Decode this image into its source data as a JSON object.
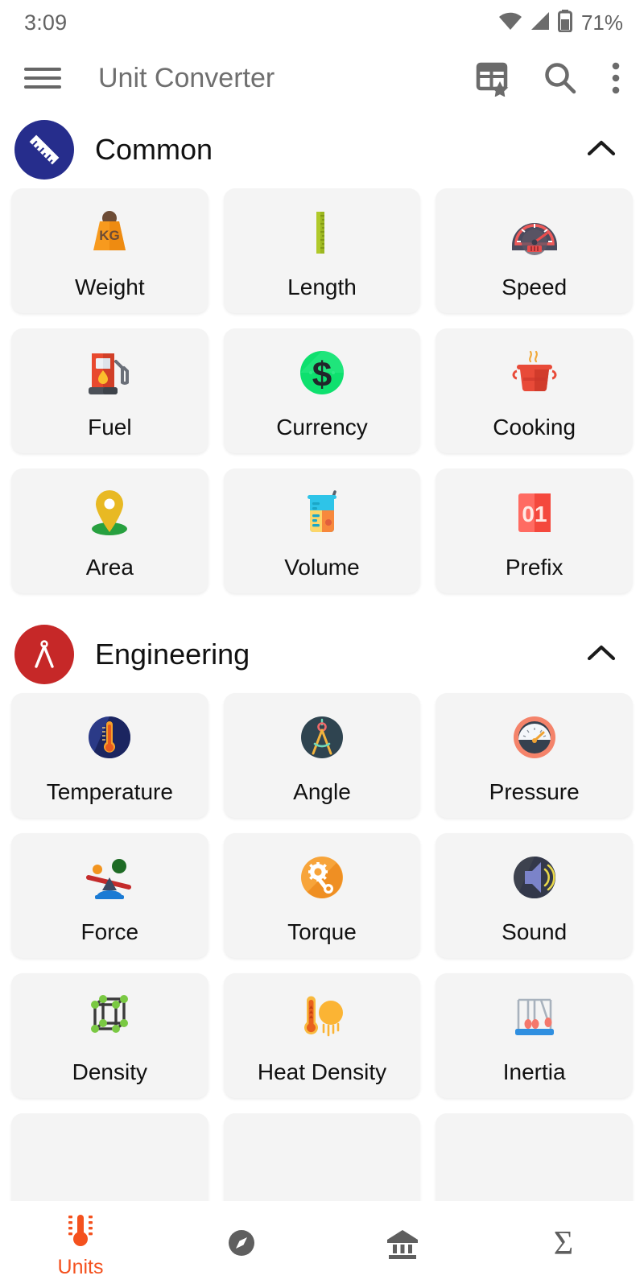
{
  "status_bar": {
    "time": "3:09",
    "battery_percent": "71%",
    "icons": [
      "wifi-icon",
      "cell-signal-icon",
      "battery-icon"
    ]
  },
  "toolbar": {
    "menu_icon": "hamburger-menu-icon",
    "title": "Unit Converter",
    "actions": [
      {
        "name": "favorites-grid-icon",
        "label": "Favorites grid"
      },
      {
        "name": "search-icon",
        "label": "Search"
      },
      {
        "name": "overflow-menu-icon",
        "label": "More options"
      }
    ]
  },
  "sections": [
    {
      "id": "common",
      "title": "Common",
      "badge_color": "#262d8c",
      "badge_icon": "ruler-icon",
      "expanded": true,
      "chevron": "chevron-up-icon",
      "items": [
        {
          "label": "Weight",
          "icon": "weight-kg-icon"
        },
        {
          "label": "Length",
          "icon": "ruler-vertical-icon"
        },
        {
          "label": "Speed",
          "icon": "speedometer-icon"
        },
        {
          "label": "Fuel",
          "icon": "fuel-pump-icon"
        },
        {
          "label": "Currency",
          "icon": "dollar-coin-icon"
        },
        {
          "label": "Cooking",
          "icon": "cooking-pot-icon"
        },
        {
          "label": "Area",
          "icon": "map-pin-icon"
        },
        {
          "label": "Volume",
          "icon": "beaker-icon"
        },
        {
          "label": "Prefix",
          "icon": "number-card-icon"
        }
      ]
    },
    {
      "id": "engineering",
      "title": "Engineering",
      "badge_color": "#c62828",
      "badge_icon": "compass-divider-icon",
      "expanded": true,
      "chevron": "chevron-up-icon",
      "items": [
        {
          "label": "Temperature",
          "icon": "thermometer-circle-icon"
        },
        {
          "label": "Angle",
          "icon": "compass-circle-icon"
        },
        {
          "label": "Pressure",
          "icon": "pressure-gauge-icon"
        },
        {
          "label": "Force",
          "icon": "lever-balance-icon"
        },
        {
          "label": "Torque",
          "icon": "wrench-gear-icon"
        },
        {
          "label": "Sound",
          "icon": "speaker-waves-icon"
        },
        {
          "label": "Density",
          "icon": "molecule-cube-icon"
        },
        {
          "label": "Heat Density",
          "icon": "thermometer-sun-icon"
        },
        {
          "label": "Inertia",
          "icon": "newtons-cradle-icon"
        }
      ]
    }
  ],
  "bottom_nav": {
    "active_color": "#f4511e",
    "inactive_color": "#5f5f5f",
    "items": [
      {
        "label": "Units",
        "icon": "thermometer-icon",
        "active": true
      },
      {
        "label": "",
        "icon": "compass-icon",
        "active": false
      },
      {
        "label": "",
        "icon": "bank-icon",
        "active": false
      },
      {
        "label": "",
        "icon": "sigma-icon",
        "active": false
      }
    ]
  }
}
